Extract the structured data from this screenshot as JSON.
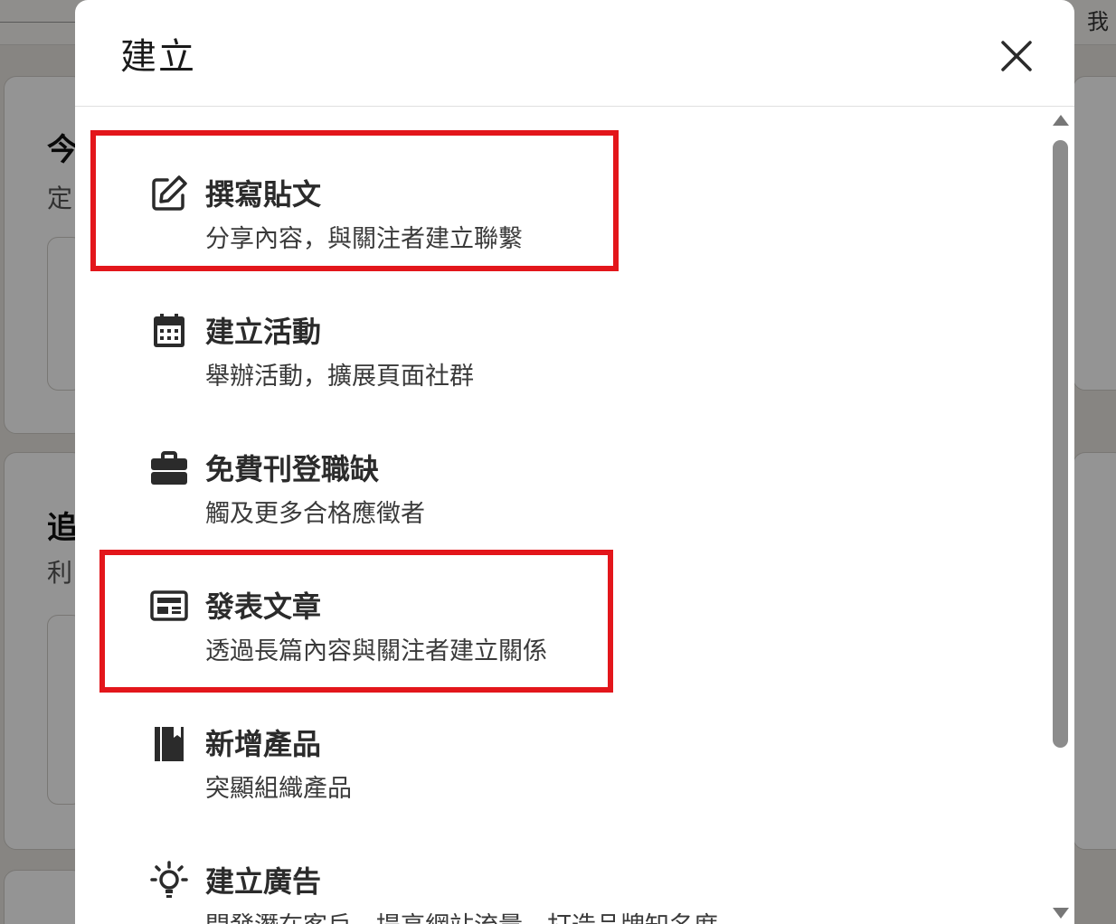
{
  "background": {
    "top_right_label": "我",
    "card1_title": "今",
    "card1_sub": "定",
    "card2_title": "追",
    "card2_sub": "利"
  },
  "modal": {
    "title": "建立",
    "close_icon": "close-icon",
    "items": [
      {
        "icon": "pencil-square-icon",
        "title": "撰寫貼文",
        "desc": "分享內容，與關注者建立聯繫",
        "highlighted": true
      },
      {
        "icon": "calendar-icon",
        "title": "建立活動",
        "desc": "舉辦活動，擴展頁面社群",
        "highlighted": false
      },
      {
        "icon": "briefcase-icon",
        "title": "免費刊登職缺",
        "desc": "觸及更多合格應徵者",
        "highlighted": false
      },
      {
        "icon": "article-icon",
        "title": "發表文章",
        "desc": "透過長篇內容與關注者建立關係",
        "highlighted": true
      },
      {
        "icon": "book-icon",
        "title": "新增產品",
        "desc": "突顯組織產品",
        "highlighted": false
      },
      {
        "icon": "lightbulb-icon",
        "title": "建立廣告",
        "desc": "開發潛在客戶、提高網站流量、打造品牌知名度",
        "highlighted": false
      }
    ]
  },
  "colors": {
    "highlight": "#e3161b",
    "text_primary": "#2b2b2b",
    "overlay": "#000000"
  }
}
